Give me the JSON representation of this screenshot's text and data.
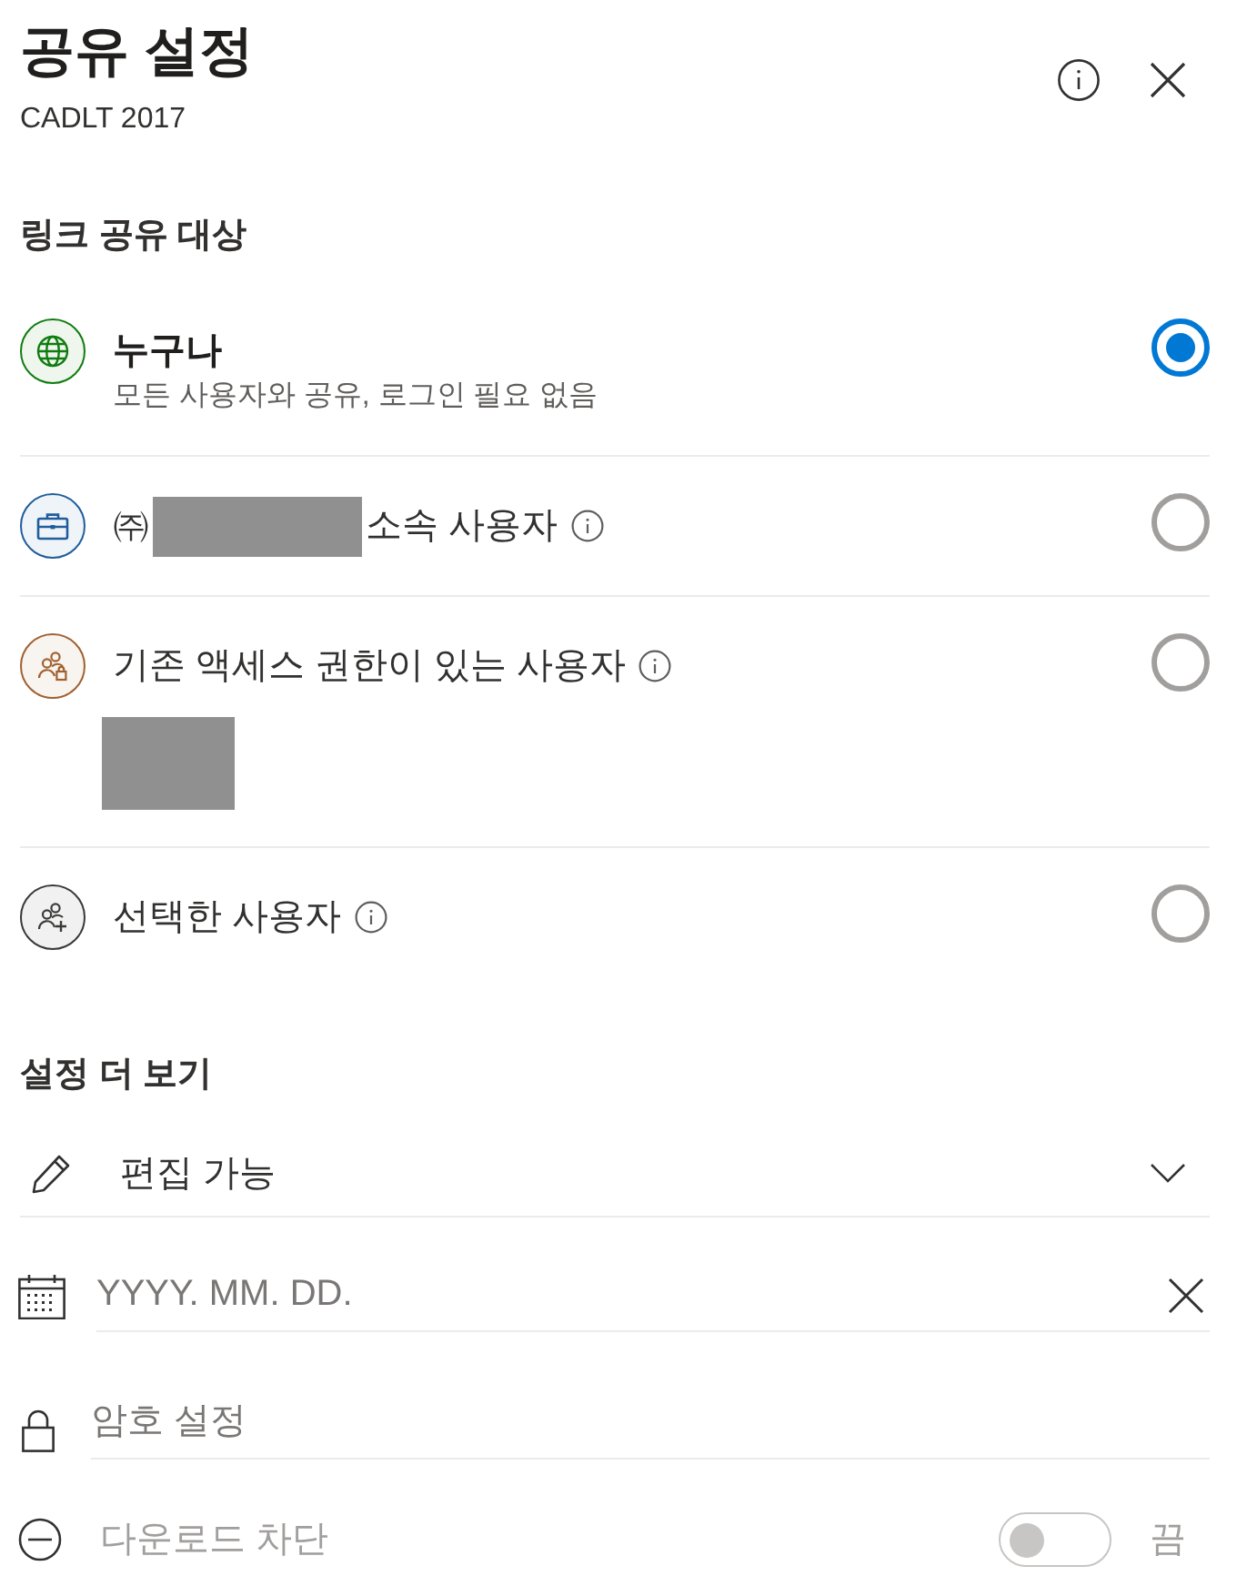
{
  "header": {
    "title": "공유 설정",
    "subtitle": "CADLT 2017"
  },
  "link_section": {
    "title": "링크 공유 대상",
    "options": [
      {
        "kind": "anyone",
        "color": "#107c10",
        "selected": true,
        "label_parts": [
          {
            "kind": "text",
            "text": "누구나"
          }
        ],
        "description": "모든 사용자와 공유, 로그인 필요 없음",
        "info": false
      },
      {
        "kind": "organization",
        "color": "#215d9c",
        "selected": false,
        "label_parts": [
          {
            "kind": "text",
            "text": "㈜"
          },
          {
            "kind": "redacted"
          },
          {
            "kind": "text",
            "text": "소속 사용자"
          }
        ],
        "info": true
      },
      {
        "kind": "existing",
        "color": "#a0612f",
        "selected": false,
        "label_parts": [
          {
            "kind": "text",
            "text": "기존 액세스 권한이 있는 사용자"
          }
        ],
        "info": true,
        "details": [
          {
            "kind": "redacted"
          }
        ]
      },
      {
        "kind": "specific",
        "color": "#3b3a39",
        "selected": false,
        "label_parts": [
          {
            "kind": "text",
            "text": "선택한 사용자"
          }
        ],
        "info": true
      }
    ]
  },
  "more_settings": {
    "title": "설정 더 보기",
    "permission": {
      "label": "편집 가능"
    },
    "expiration": {
      "placeholder": "YYYY. MM. DD."
    },
    "password": {
      "placeholder": "암호 설정"
    },
    "block_download": {
      "label": "다운로드 차단",
      "disabled": true,
      "on": false,
      "state_label": "끔"
    }
  }
}
